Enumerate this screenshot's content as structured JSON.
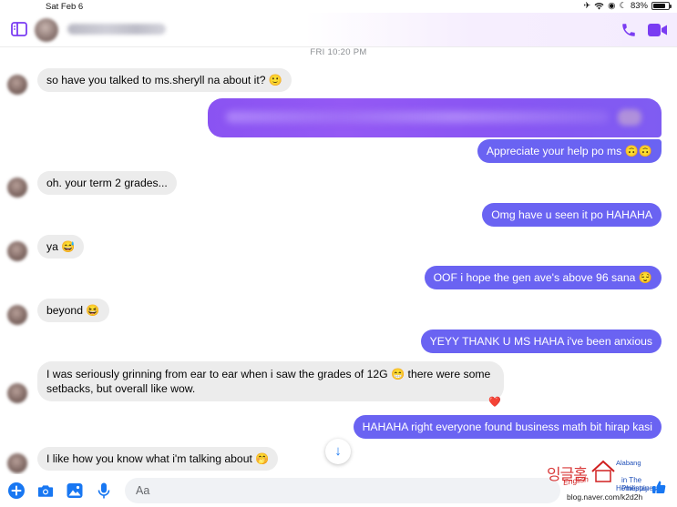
{
  "status_bar": {
    "time": "Sat Feb 6",
    "battery": "83%",
    "battery_level": 0.83
  },
  "header": {
    "contact_name": ""
  },
  "thread": {
    "timestamp": "FRI 10:20 PM",
    "messages": [
      {
        "dir": "in",
        "text": "so have you talked to ms.sheryll na about it? 🙂"
      },
      {
        "dir": "out",
        "text": ""
      },
      {
        "dir": "out",
        "text": "Appreciate your help po ms 🙃🙃"
      },
      {
        "dir": "in",
        "text": "oh. your term 2 grades..."
      },
      {
        "dir": "out",
        "text": "Omg have u seen it po HAHAHA"
      },
      {
        "dir": "in",
        "text": "ya 😅"
      },
      {
        "dir": "out",
        "text": "OOF i hope the gen ave's above 96 sana 😌"
      },
      {
        "dir": "in",
        "text": "beyond 😆"
      },
      {
        "dir": "out",
        "text": "YEYY THANK U MS HAHA i've been anxious"
      },
      {
        "dir": "in",
        "text": "I was seriously grinning from ear to ear when i saw the grades of 12G 😁 there were some setbacks, but overall like wow."
      },
      {
        "dir": "out",
        "text": "HAHAHA right everyone found business math bit hirap kasi"
      },
      {
        "dir": "in",
        "text": "I like how you know what i'm talking about 🤭"
      }
    ],
    "reaction": "❤️"
  },
  "composer": {
    "placeholder": "Aa"
  },
  "watermark": {
    "korean": "잉글홈",
    "english": "English",
    "alabang": "Alabang",
    "in_philippines": "in The Philippines",
    "homestay": "Homestay",
    "url": "blog.naver.com/k2d2h"
  },
  "colors": {
    "accent": "#7a3cf2",
    "outgoing_bubble": "#6a63f2",
    "incoming_bubble": "#ececec",
    "messenger_blue": "#1877f2"
  },
  "icons": [
    "sidebar-toggle-icon",
    "phone-icon",
    "video-camera-icon",
    "plus-icon",
    "camera-icon",
    "gallery-icon",
    "microphone-icon",
    "arrow-down-icon",
    "thumbs-up-icon",
    "heart-icon"
  ]
}
